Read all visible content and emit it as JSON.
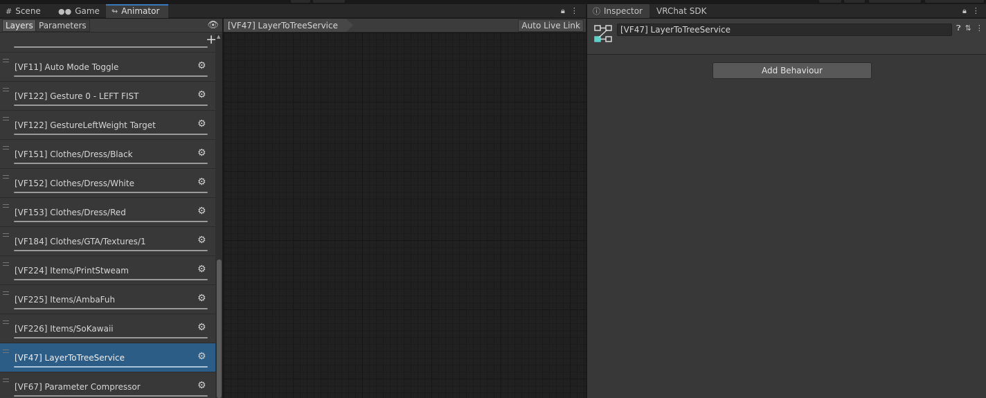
{
  "tabs_left": [
    {
      "label": "Scene",
      "icon": "grid-icon"
    },
    {
      "label": "Game",
      "icon": "gamepad-icon"
    },
    {
      "label": "Animator",
      "icon": "animator-icon"
    }
  ],
  "tabs_right": [
    {
      "label": "Inspector",
      "icon": "info-icon"
    },
    {
      "label": "VRChat SDK"
    }
  ],
  "animator": {
    "panel_tabs": [
      "Layers",
      "Parameters"
    ],
    "breadcrumb": "[VF47] LayerToTreeService",
    "auto_live_link": "Auto Live Link",
    "layers": [
      "[VF11] Auto Mode Toggle",
      "[VF122] Gesture 0 - LEFT FIST",
      "[VF122] GestureLeftWeight Target",
      "[VF151] Clothes/Dress/Black",
      "[VF152] Clothes/Dress/White",
      "[VF153] Clothes/Dress/Red",
      "[VF184] Clothes/GTA/Textures/1",
      "[VF224] Items/PrintStweam",
      "[VF225] Items/AmbaFuh",
      "[VF226] Items/SoKawaii",
      "[VF47] LayerToTreeService",
      "[VF67] Parameter Compressor"
    ],
    "selected_index": 10
  },
  "inspector": {
    "object_name": "[VF47] LayerToTreeService",
    "add_behaviour": "Add Behaviour"
  },
  "colors": {
    "selection": "#2c5d87",
    "accent": "#3a79bb",
    "tree_icon_accent": "#5fd1c9"
  }
}
